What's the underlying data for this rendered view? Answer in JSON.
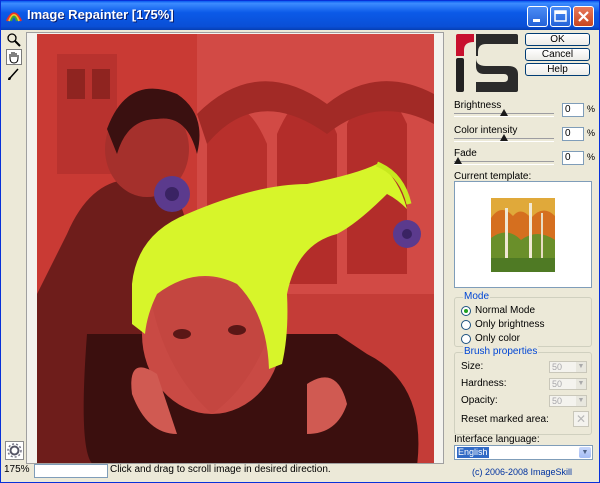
{
  "window": {
    "title": "Image Repainter [175%]",
    "minimize_icon": "minimize-icon",
    "maximize_icon": "maximize-icon",
    "close_icon": "close-icon"
  },
  "toolbar": {
    "tools": [
      {
        "name": "zoom-tool",
        "icon": "magnifier-icon"
      },
      {
        "name": "hand-tool",
        "icon": "hand-icon",
        "active": true
      },
      {
        "name": "brush-tool",
        "icon": "brush-icon"
      }
    ]
  },
  "status": {
    "zoom": "175%",
    "box_value": "",
    "hint": "Click and drag to scroll image in desired direction."
  },
  "buttons": {
    "ok": "OK",
    "cancel": "Cancel",
    "help": "Help"
  },
  "adjustments": {
    "brightness": {
      "label": "Brightness",
      "value": "0",
      "unit": "%",
      "level": 0.5
    },
    "color_intensity": {
      "label": "Color intensity",
      "value": "0",
      "unit": "%",
      "level": 0.5
    },
    "fade": {
      "label": "Fade",
      "value": "0",
      "unit": "%",
      "level": 0.0
    }
  },
  "template": {
    "label": "Current template:"
  },
  "mode": {
    "title": "Mode",
    "options": [
      "Normal Mode",
      "Only brightness",
      "Only color"
    ],
    "selected": "Normal Mode"
  },
  "brush": {
    "title": "Brush properties",
    "size_label": "Size:",
    "size_value": "50",
    "hardness_label": "Hardness:",
    "hardness_value": "50",
    "opacity_label": "Opacity:",
    "opacity_value": "50",
    "reset_label": "Reset marked area:"
  },
  "language": {
    "label": "Interface language:",
    "value": "English"
  },
  "footer": {
    "copyright": "(c) 2006-2008 ImageSkill"
  },
  "colors": {
    "titlebar": "#0a4fd6",
    "overlay_red": "#d23c34",
    "hat_green": "#d7f52a",
    "group_title": "#0046d5"
  }
}
